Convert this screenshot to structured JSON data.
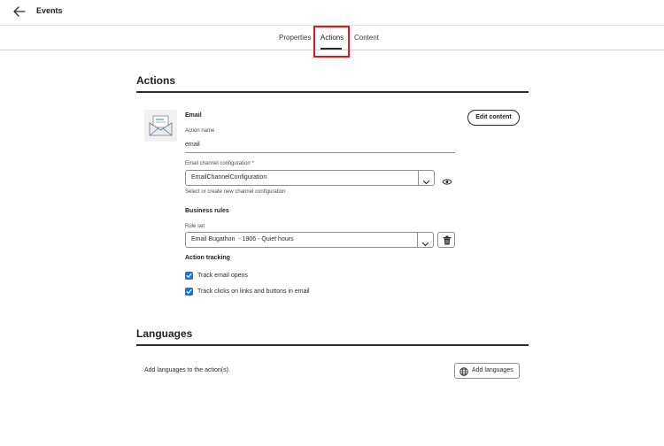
{
  "app": {
    "title": "Events",
    "back_icon": "arrow-left-icon"
  },
  "tabs": [
    {
      "label": "Properties",
      "selected": false
    },
    {
      "label": "Actions",
      "selected": true
    },
    {
      "label": "Content",
      "selected": false
    }
  ],
  "actions_section": {
    "title": "Actions",
    "action": {
      "icon": "email-icon",
      "type_label": "Email",
      "edit_button_label": "Edit content",
      "action_name": {
        "label": "Action name",
        "value": "email"
      },
      "channel_config": {
        "label": "Email channel configuration",
        "required_marker": "*",
        "selected_value": "EmailChannelConfiguration",
        "help_text": "Select or create new channel configuration",
        "preview_icon": "eye-icon"
      },
      "business_rules": {
        "heading": "Business rules",
        "rule_set_label": "Rule set",
        "selected_value": "Email Bugathon  - 1906 - Quiet hours",
        "delete_icon": "trash-icon"
      },
      "tracking": {
        "heading": "Action tracking",
        "options": [
          {
            "label": "Track email opens",
            "checked": true
          },
          {
            "label": "Track clicks on links and buttons in email",
            "checked": true
          }
        ]
      }
    }
  },
  "languages_section": {
    "title": "Languages",
    "description": "Add languages to the action(s).",
    "add_button_label": "Add languages",
    "add_button_icon": "globe-icon"
  },
  "colors": {
    "accent": "#1473e6",
    "highlight": "#e0191e",
    "text": "#2c2c2c"
  }
}
